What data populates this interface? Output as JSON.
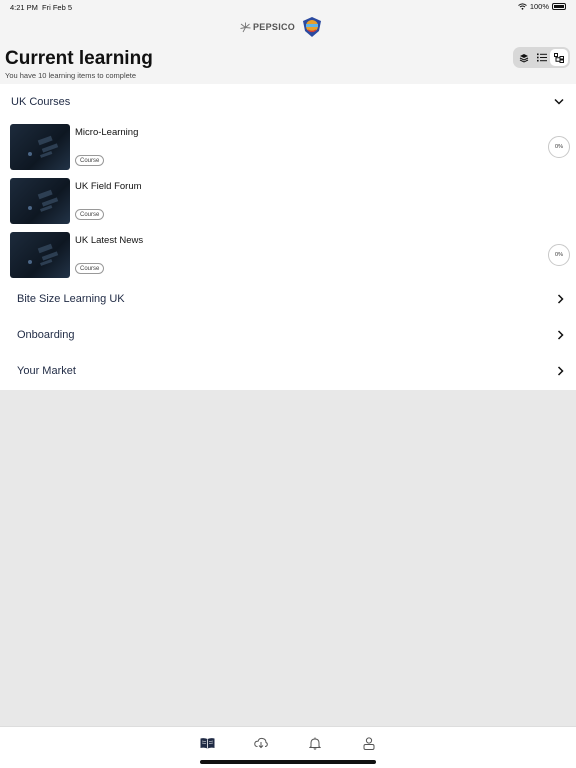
{
  "status_bar": {
    "time": "4:21 PM",
    "date": "Fri Feb 5",
    "battery": "100%"
  },
  "header": {
    "brand_text": "PEPSICO",
    "title": "Current learning",
    "subtitle": "You have 10 learning items to complete"
  },
  "view_toggle": {
    "options": [
      "stack-icon",
      "list-icon",
      "tree-icon"
    ],
    "selected": "tree-icon"
  },
  "section": {
    "title": "UK Courses",
    "items": [
      {
        "title": "Micro-Learning",
        "tag": "Course",
        "progress": "0%"
      },
      {
        "title": "UK Field Forum",
        "tag": "Course"
      },
      {
        "title": "UK Latest News",
        "tag": "Course",
        "progress": "0%"
      }
    ]
  },
  "categories": [
    {
      "label": "Bite Size Learning UK"
    },
    {
      "label": "Onboarding"
    },
    {
      "label": "Your Market"
    }
  ],
  "tabbar": {
    "tabs": [
      "book-icon",
      "download-icon",
      "bell-icon",
      "profile-icon"
    ],
    "active": "book-icon"
  },
  "colors": {
    "accent": "#1f2a44",
    "background": "#e8e8e8"
  }
}
